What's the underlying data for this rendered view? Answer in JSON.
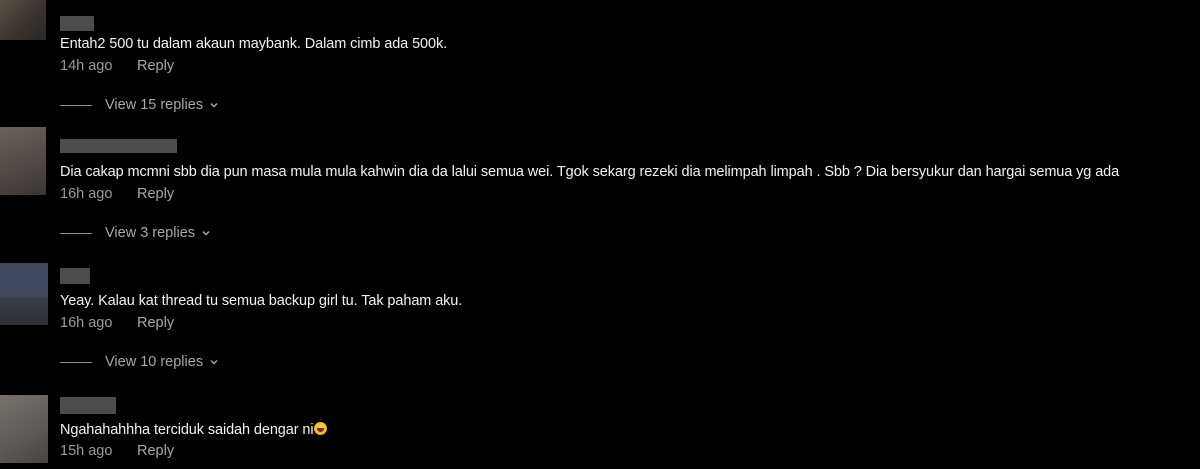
{
  "comments": [
    {
      "text": "Entah2 500 tu dalam akaun maybank. Dalam cimb ada 500k.",
      "time": "14h ago",
      "reply_label": "Reply",
      "replies_label": "View 15 replies"
    },
    {
      "text": "Dia cakap mcmni sbb dia pun masa mula mula kahwin dia da lalui semua wei. Tgok sekarg rezeki dia melimpah limpah . Sbb ? Dia bersyukur dan hargai semua yg ada",
      "time": "16h ago",
      "reply_label": "Reply",
      "replies_label": "View 3 replies"
    },
    {
      "text": "Yeay. Kalau kat thread tu semua backup girl tu. Tak paham aku.",
      "time": "16h ago",
      "reply_label": "Reply",
      "replies_label": "View 10 replies"
    },
    {
      "text": "Ngahahahhha terciduk saidah dengar ni",
      "emoji": "laughing-emoji",
      "time": "15h ago",
      "reply_label": "Reply"
    }
  ],
  "colors": {
    "background": "#000000",
    "text": "#f2f2f2",
    "muted": "#9a9a9a"
  },
  "icons": {
    "chevron": "chevron-down-icon"
  }
}
